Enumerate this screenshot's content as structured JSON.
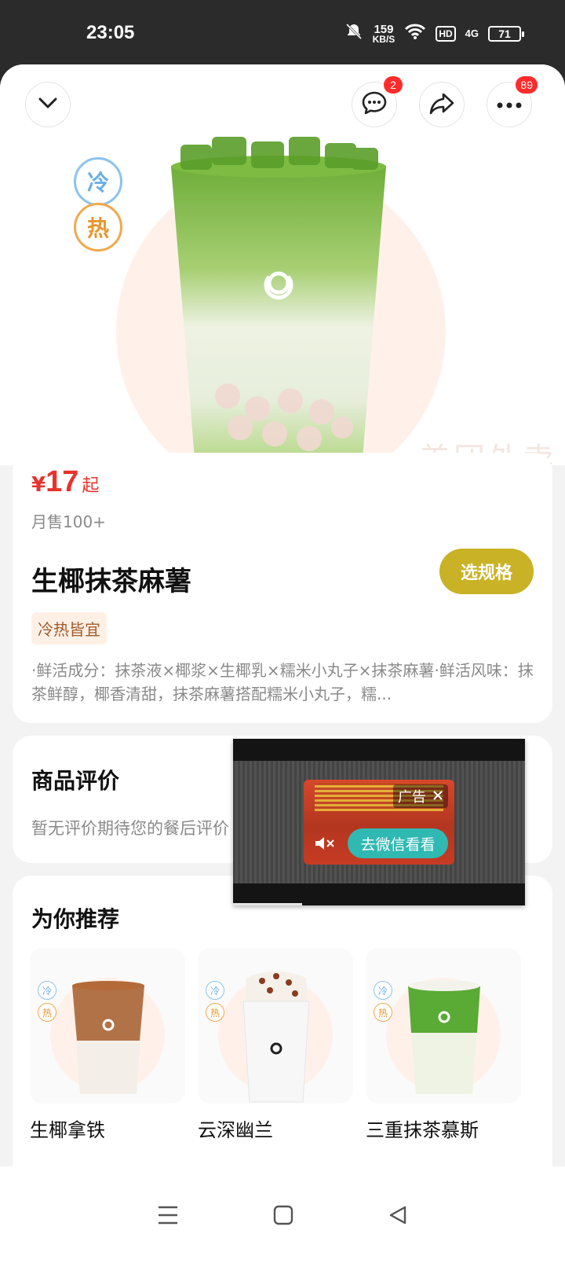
{
  "status_bar": {
    "time": "23:05",
    "net_speed": "159",
    "net_unit": "KB/S",
    "hd": "HD",
    "signal": "4G",
    "battery": "71"
  },
  "header": {
    "messages_badge": "2",
    "more_badge": "89"
  },
  "hero": {
    "cold_tag": "冷",
    "hot_tag": "热",
    "watermark": "美团外卖"
  },
  "product": {
    "currency": "¥",
    "price": "17",
    "price_suffix": "起",
    "monthly_sales": "月售100+",
    "name": "生椰抹茶麻薯",
    "select_spec_label": "选规格",
    "feature_tag": "冷热皆宜",
    "description": "·鲜活成分：抹茶液×椰浆×生椰乳×糯米小丸子×抹茶麻薯·鲜活风味：抹茶鲜醇，椰香清甜，抹茶麻薯搭配糯米小丸子，糯..."
  },
  "reviews": {
    "title": "商品评价",
    "empty_text": "暂无评价期待您的餐后评价"
  },
  "ad": {
    "label": "广告",
    "cta": "去微信看看"
  },
  "recommend": {
    "title": "为你推荐",
    "items": [
      {
        "name": "生椰拿铁",
        "cold": "冷",
        "hot": "热",
        "color": "#b0683a"
      },
      {
        "name": "云深幽兰",
        "cold": "冷",
        "hot": "热",
        "color": "#f2efe9"
      },
      {
        "name": "三重抹茶慕斯",
        "cold": "冷",
        "hot": "热",
        "color": "#58a938"
      }
    ]
  },
  "colors": {
    "price_red": "#e8322c",
    "spec_button": "#c9b226",
    "badge_red": "#ff2b2b",
    "cold_blue": "#8cc3ee",
    "hot_orange": "#f0a94c"
  }
}
